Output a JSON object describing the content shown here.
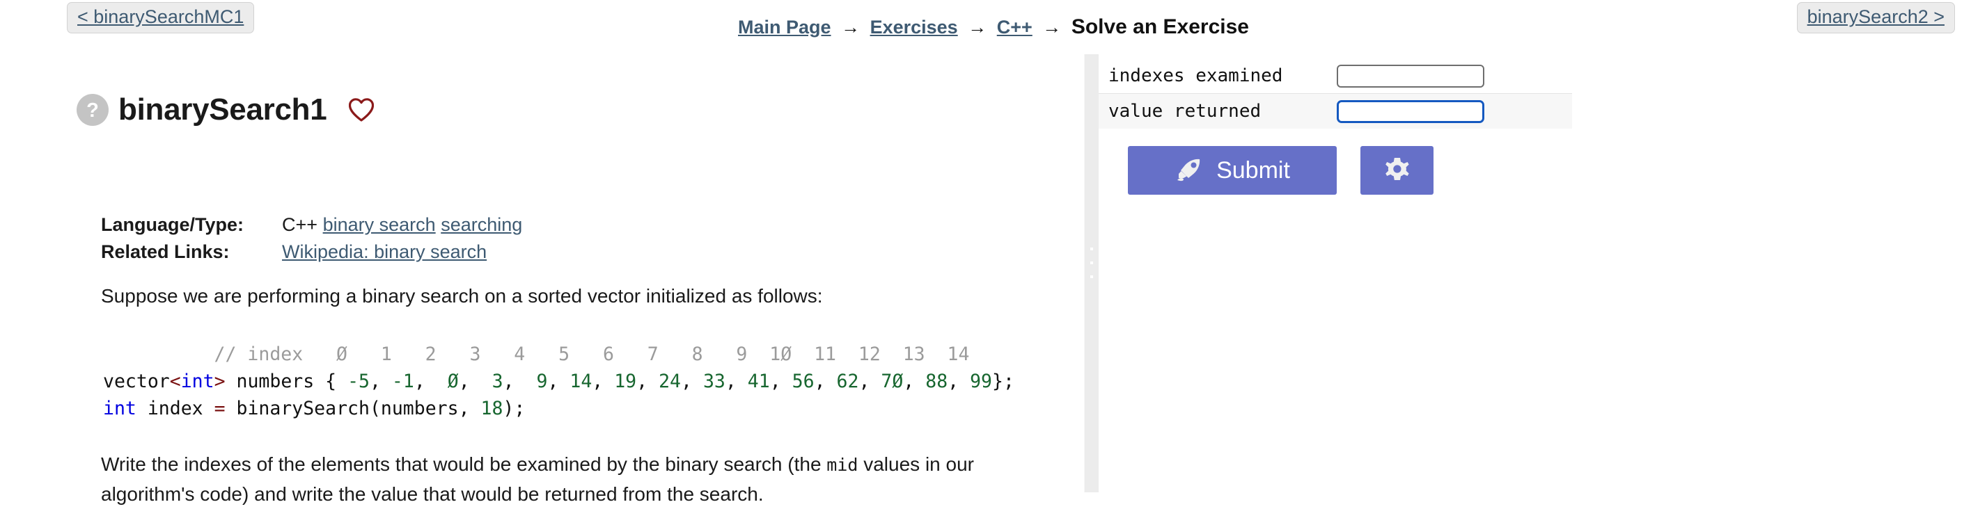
{
  "nav": {
    "prev_label": "< binarySearchMC1",
    "next_label": "binarySearch2 >",
    "breadcrumb": {
      "items": [
        {
          "label": "Main Page",
          "link": true
        },
        {
          "label": "Exercises",
          "link": true
        },
        {
          "label": "C++",
          "link": true
        },
        {
          "label": "Solve an Exercise",
          "link": false
        }
      ],
      "separator": "→"
    }
  },
  "exercise": {
    "help_icon": "question-circle-icon",
    "title": "binarySearch1",
    "favorite_icon": "heart-outline-icon",
    "meta": {
      "language_label": "Language/Type:",
      "language_prefix": "C++",
      "language_links": [
        "binary search",
        "searching"
      ],
      "related_label": "Related Links:",
      "related_links": [
        "Wikipedia: binary search"
      ]
    },
    "intro": "Suppose we are performing a binary search on a sorted vector initialized as follows:",
    "code": {
      "comment_prefix": "          // index",
      "indexes": [
        "Ø",
        "1",
        "2",
        "3",
        "4",
        "5",
        "6",
        "7",
        "8",
        "9",
        "1Ø",
        "11",
        "12",
        "13",
        "14"
      ],
      "declaration_prefix": "vector",
      "lt": "<",
      "type_keyword": "int",
      "gt": ">",
      "var_name": " numbers {",
      "values": [
        "-5",
        "-1",
        "Ø",
        "3",
        "9",
        "14",
        "19",
        "24",
        "33",
        "41",
        "56",
        "62",
        "7Ø",
        "88",
        "99"
      ],
      "declaration_suffix": "};",
      "call_keyword": "int",
      "call_var": " index ",
      "call_equals": "=",
      "call_expr": " binarySearch(numbers, ",
      "call_arg": "18",
      "call_suffix": ");"
    },
    "outro_part1": "Write the indexes of the elements that would be examined by the binary search (the ",
    "outro_mono": "mid",
    "outro_part2": " values in our algorithm's code) and write the value that would be returned from the search."
  },
  "answers": {
    "rows": [
      {
        "label": "indexes examined",
        "value": "",
        "placeholder": "",
        "focused": false
      },
      {
        "label": "value returned",
        "value": "",
        "placeholder": "",
        "focused": true
      }
    ]
  },
  "actions": {
    "submit_label": "Submit",
    "submit_icon": "rocket-icon",
    "settings_icon": "gear-icon"
  },
  "colors": {
    "link": "#3e5a72",
    "button_purple": "#6670c8",
    "heart_red": "#8b1a1a",
    "focus_blue": "#1559c0",
    "code_keyword": "#0000e0",
    "code_number": "#17662f",
    "code_operator": "#7a1111",
    "code_comment": "#9b9b9b"
  }
}
